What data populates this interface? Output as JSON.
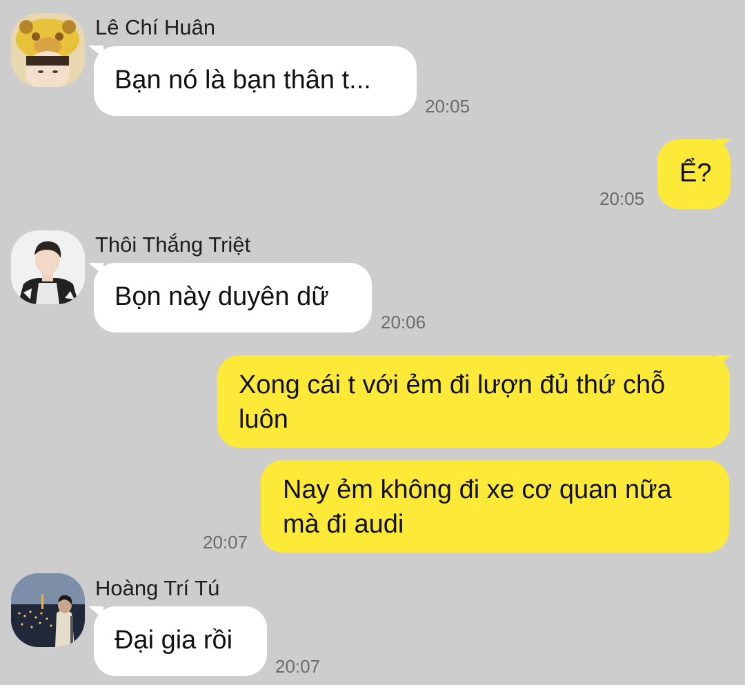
{
  "messages": [
    {
      "sender": "Lê Chí Huân",
      "avatar": "giraffe-hat-avatar-icon",
      "text": "Bạn nó là bạn thân t...",
      "time": "20:05"
    },
    {
      "text": "Ể?",
      "time": "20:05"
    },
    {
      "sender": "Thôi Thắng Triệt",
      "avatar": "portrait-avatar-icon",
      "text": "Bọn này duyên dữ",
      "time": "20:06"
    },
    {
      "text": "Xong cái t với ẻm đi lượn đủ thứ chỗ luôn"
    },
    {
      "text": "Nay ẻm không đi xe cơ quan nữa mà đi audi",
      "time": "20:07"
    },
    {
      "sender": "Hoàng Trí Tú",
      "avatar": "night-city-avatar-icon",
      "text": "Đại gia rồi",
      "time": "20:07"
    }
  ],
  "colors": {
    "background": "#cdcdcd",
    "incoming_bubble": "#ffffff",
    "outgoing_bubble": "#fde938",
    "time_text": "#6b6b6b"
  }
}
